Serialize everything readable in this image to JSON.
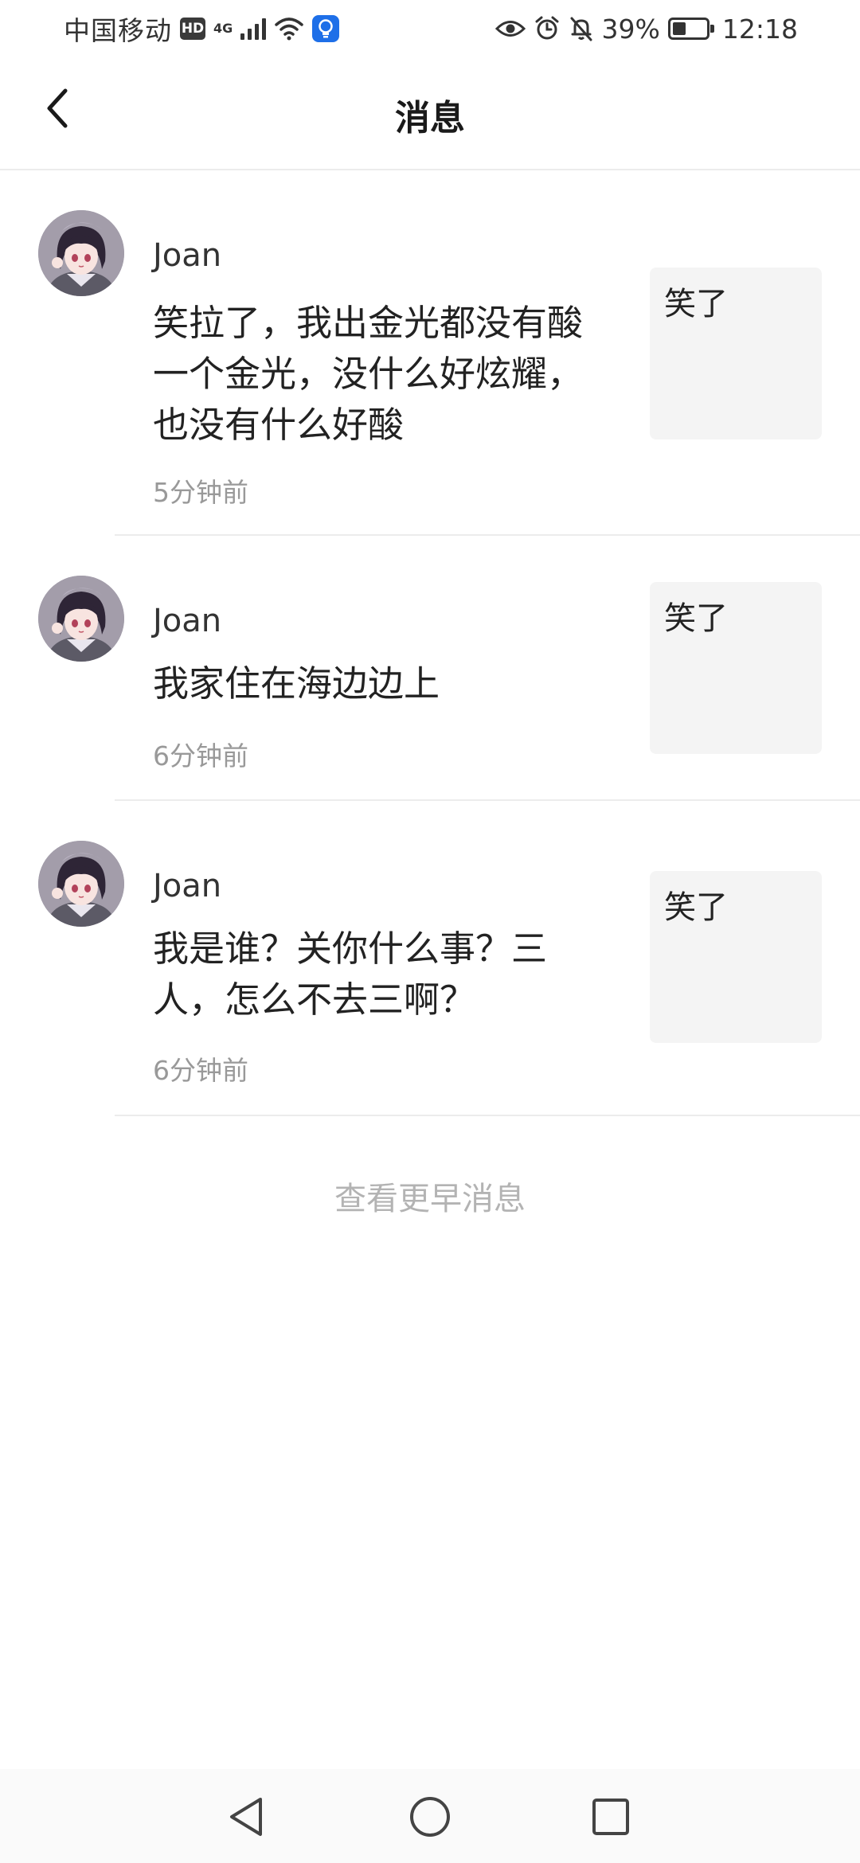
{
  "status_bar": {
    "carrier": "中国移动",
    "hd_badge": "HD",
    "network_type": "4G",
    "icons": [
      "signal-icon",
      "wifi-icon",
      "bulb-icon",
      "eye-icon",
      "alarm-icon",
      "mute-icon",
      "battery-icon"
    ],
    "battery_percent": "39%",
    "battery_level": 0.39,
    "time": "12:18"
  },
  "header": {
    "title": "消息",
    "back_icon": "chevron-left-icon"
  },
  "messages": [
    {
      "sender": "Joan",
      "text": "笑拉了，我出金光都没有酸一个金光，没什么好炫耀，也没有什么好酸",
      "time": "5分钟前",
      "quoted": "笑了"
    },
    {
      "sender": "Joan",
      "text": "我家住在海边边上",
      "time": "6分钟前",
      "quoted": "笑了"
    },
    {
      "sender": "Joan",
      "text": "我是谁？关你什么事？三人，怎么不去三啊？",
      "time": "6分钟前",
      "quoted": "笑了"
    }
  ],
  "footer": {
    "earlier_label": "查看更早消息"
  },
  "nav_bar": {
    "icons": [
      "back-triangle-icon",
      "home-circle-icon",
      "recents-square-icon"
    ]
  },
  "colors": {
    "divider": "#ececec",
    "quote_bg": "#f4f4f4",
    "muted_text": "#999999",
    "link_text": "#b3b3b3",
    "bulb_blue": "#1e6fe8"
  }
}
